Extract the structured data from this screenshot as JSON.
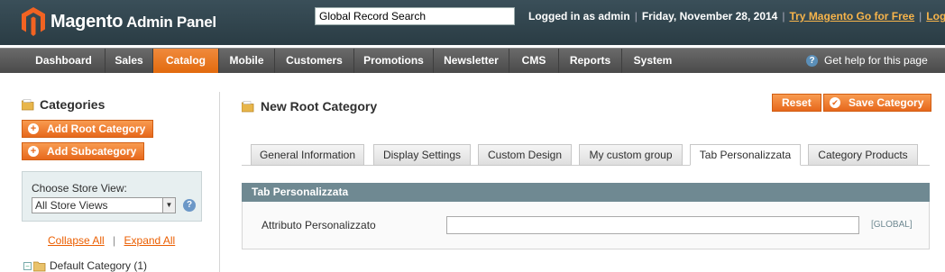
{
  "header": {
    "brand": "Magento",
    "brand_sub": "Admin Panel",
    "search_value": "Global Record Search",
    "logged_in": "Logged in as admin",
    "date": "Friday, November 28, 2014",
    "try_link": "Try Magento Go for Free",
    "logout_link": "Log Out"
  },
  "nav": {
    "items": [
      "Dashboard",
      "Sales",
      "Catalog",
      "Mobile",
      "Customers",
      "Promotions",
      "Newsletter",
      "CMS",
      "Reports",
      "System"
    ],
    "active": "Catalog",
    "help": "Get help for this page"
  },
  "sidebar": {
    "title": "Categories",
    "add_root": "Add Root Category",
    "add_sub": "Add Subcategory",
    "store_label": "Choose Store View:",
    "store_value": "All Store Views",
    "collapse_all": "Collapse All",
    "expand_all": "Expand All",
    "separator": "|",
    "tree_root": "Default Category (1)"
  },
  "main": {
    "title": "New Root Category",
    "reset_label": "Reset",
    "save_label": "Save Category",
    "tabs": [
      "General Information",
      "Display Settings",
      "Custom Design",
      "My custom group",
      "Tab Personalizzata",
      "Category Products"
    ],
    "active_tab": "Tab Personalizzata",
    "section_title": "Tab Personalizzata",
    "field_label": "Attributo Personalizzato",
    "field_value": "",
    "field_scope": "[GLOBAL]"
  },
  "colors": {
    "accent": "#e7681c",
    "header_bg": "#2a3c44",
    "section_head": "#6f8992"
  }
}
